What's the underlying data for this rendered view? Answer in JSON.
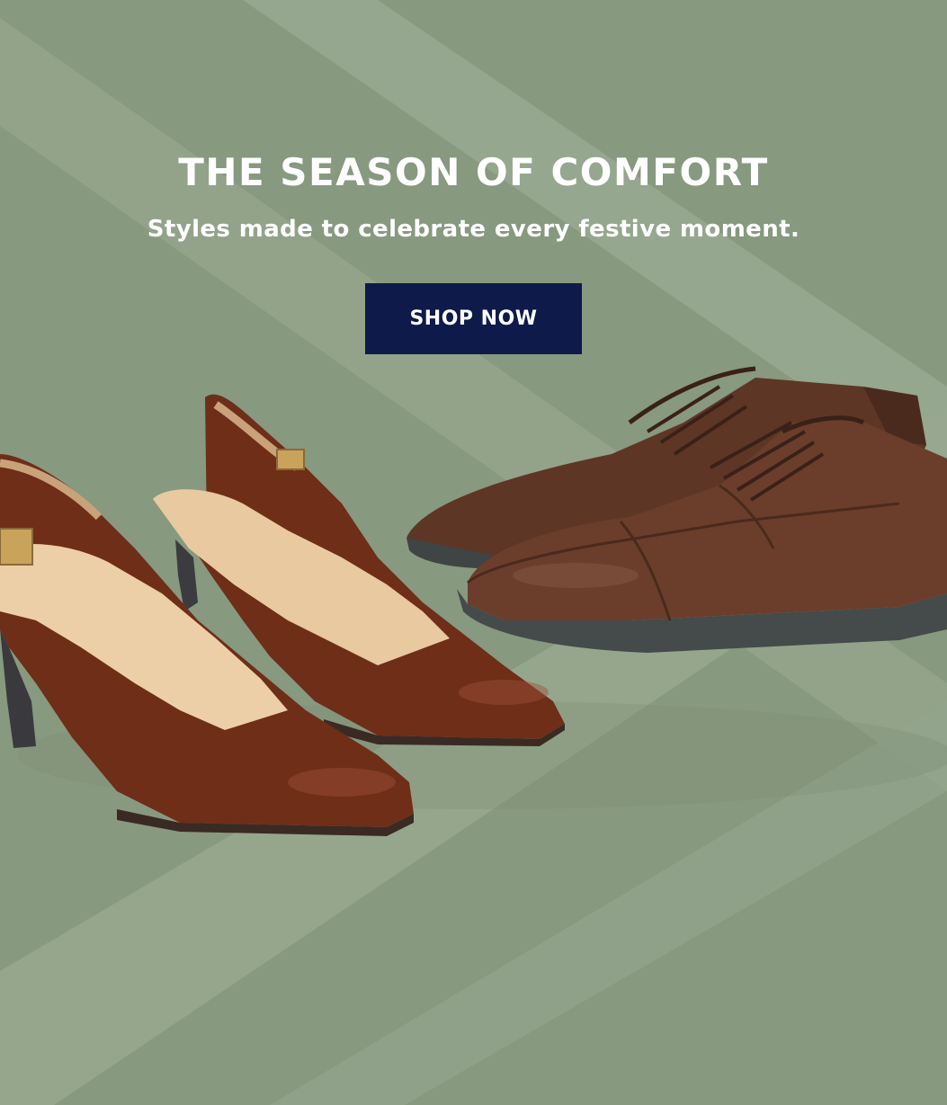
{
  "banner": {
    "headline": "THE SEASON OF COMFORT",
    "subheadline": "Styles made to celebrate every festive moment.",
    "cta_label": "SHOP NOW"
  },
  "colors": {
    "background": "#87997f",
    "stripe": "#9aab93",
    "button": "#0d1a4a",
    "heel_leather": "#6e2e18",
    "oxford_leather": "#5a3324"
  },
  "images": {
    "left_product": "slingback-pump-croc-brown",
    "right_product": "cap-toe-oxford-brown"
  }
}
